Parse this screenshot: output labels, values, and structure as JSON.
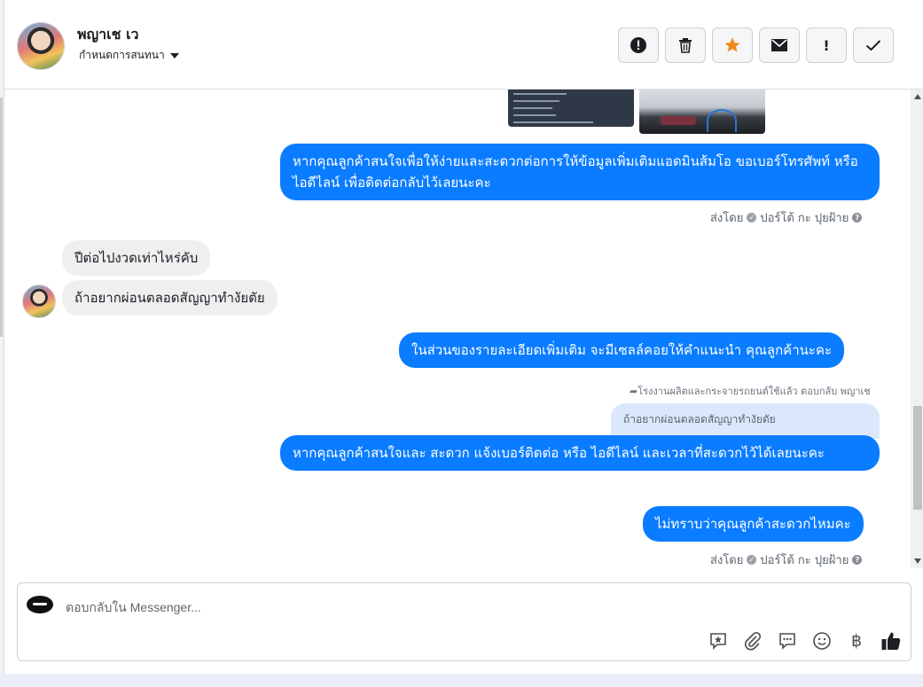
{
  "header": {
    "contact_name": "พญาเช เว",
    "assign_label": "กำหนดการสนทนา",
    "actions": [
      {
        "name": "alert-icon",
        "glyph": "!"
      },
      {
        "name": "trash-icon",
        "glyph": "🗑"
      },
      {
        "name": "star-icon",
        "glyph": "★"
      },
      {
        "name": "mail-icon",
        "glyph": "✉"
      },
      {
        "name": "exclamation-icon",
        "glyph": "!"
      },
      {
        "name": "check-icon",
        "glyph": "✓"
      }
    ]
  },
  "messages": {
    "m1": "หากคุณลูกค้าสนใจเพื่อให้ง่ายและสะดวกต่อการให้ข้อมูลเพิ่มเติมแอดมินส้มโอ ขอเบอร์โทรศัพท์ หรือ ไอดีไลน์ เพื่อติดต่อกลับไว้เลยนะคะ",
    "sentby_1": "ส่งโดย",
    "sentby_name_1": "ปอร์โต้ กะ ปุยฝ้าย",
    "m2": "ปีต่อไปงวดเท่าไหร่คับ",
    "m3": "ถ้าอยากผ่อนตลอดสัญญาทำงัยตัย",
    "m4": "ในส่วนของรายละเอียดเพิ่มเติม จะมีเซลล์คอยให้คำแนะนำ คุณลูกค้านะคะ",
    "reply_meta": "โรงงานผลิตและกระจายรถยนต์ใช้แล้ว ตอบกลับ พญาเช",
    "quoted": "ถ้าอยากผ่อนตลอดสัญญาทำงัยตัย",
    "m5": "หากคุณลูกค้าสนใจและ สะดวก แจ้งเบอร์ติดต่อ หรือ ไอดีไลน์ และเวลาที่สะดวกไว้ได้เลยนะคะ",
    "m6": "ไม่ทราบว่าคุณลูกค้าสะดวกไหมคะ",
    "sentby_2": "ส่งโดย",
    "sentby_name_2": "ปอร์โต้ กะ ปุยฝ้าย"
  },
  "composer": {
    "placeholder": "ตอบกลับใน Messenger...",
    "tools": [
      {
        "name": "saved-reply-icon",
        "glyph": "✪"
      },
      {
        "name": "attachment-icon",
        "glyph": "⌀"
      },
      {
        "name": "chat-bubble-icon",
        "glyph": "…"
      },
      {
        "name": "emoji-icon",
        "glyph": "☺"
      },
      {
        "name": "baht-icon",
        "glyph": "฿"
      },
      {
        "name": "like-icon",
        "glyph": "👍"
      }
    ]
  },
  "colors": {
    "outgoing": "#0a7cff",
    "incoming": "#eeeff1",
    "star": "#f08a1c"
  }
}
